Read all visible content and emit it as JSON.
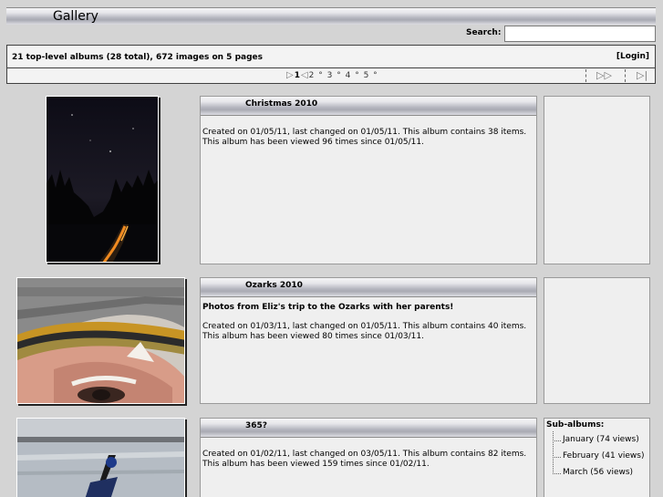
{
  "header": {
    "title": "Gallery"
  },
  "search": {
    "label": "Search:",
    "value": "",
    "placeholder": ""
  },
  "summary": {
    "text": "21 top-level albums (28 total), 672 images on 5 pages",
    "login": "[Login]"
  },
  "pager": {
    "pages": [
      "1",
      "2",
      "3",
      "4",
      "5"
    ],
    "current": "1"
  },
  "albums": [
    {
      "title": "Christmas 2010",
      "description": "",
      "meta_line1": "Created on 01/05/11, last changed on 01/05/11. This album contains 38 items.",
      "meta_line2": "This album has been viewed 96 times since 01/05/11."
    },
    {
      "title": "Ozarks 2010",
      "description": "Photos from Eliz's trip to the Ozarks with her parents!",
      "meta_line1": "Created on 01/03/11, last changed on 01/05/11. This album contains 40 items.",
      "meta_line2": "This album has been viewed 80 times since 01/03/11."
    },
    {
      "title": "365?",
      "description": "",
      "meta_line1": "Created on 01/02/11, last changed on 03/05/11. This album contains 82 items.",
      "meta_line2": "This album has been viewed 159 times since 01/02/11.",
      "subalbums_label": "Sub-albums:",
      "subalbums": [
        {
          "label": "January (74 views)"
        },
        {
          "label": "February (41 views)"
        },
        {
          "label": "March (56 views)"
        }
      ]
    }
  ],
  "colors": {
    "background": "#d4d4d4",
    "panel": "#efefef",
    "border": "#404040"
  },
  "icons": [
    "next-page-icon",
    "prev-page-icon",
    "fast-forward-icon",
    "last-page-icon"
  ]
}
